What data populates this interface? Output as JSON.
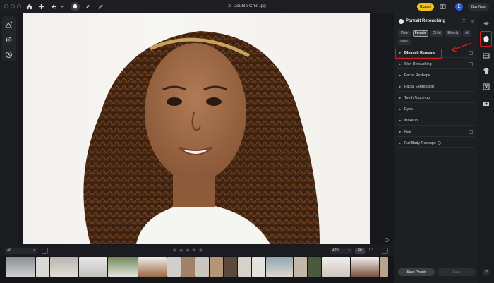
{
  "window": {
    "title": "2. Double Chin.jpg"
  },
  "topbar": {
    "export_label": "Export",
    "avatar_initial": "E",
    "buy_label": "Buy Now"
  },
  "filmstrip_bar": {
    "filter_value": "All",
    "stars": "★★★★★",
    "zoom_value": "47%",
    "fit_label": "Fit",
    "one_label": "1:1"
  },
  "panel": {
    "title": "Portrait Retouching",
    "chips": [
      "Male",
      "Female",
      "Child",
      "Elderly",
      "All",
      "Indiv."
    ],
    "active_chip": "Female",
    "sections": [
      "Blemish Removal",
      "Skin Retouching",
      "Facial Reshape",
      "Facial Expression",
      "Teeth Touch-up",
      "Eyes",
      "Makeup",
      "Hair",
      "Full Body Reshape"
    ],
    "save_preset_label": "Save Preset",
    "save_label": "Save"
  },
  "help_label": "?",
  "colors": {
    "accent": "#f0c419",
    "highlight": "#d11f1f",
    "avatar": "#2b5fd9"
  }
}
